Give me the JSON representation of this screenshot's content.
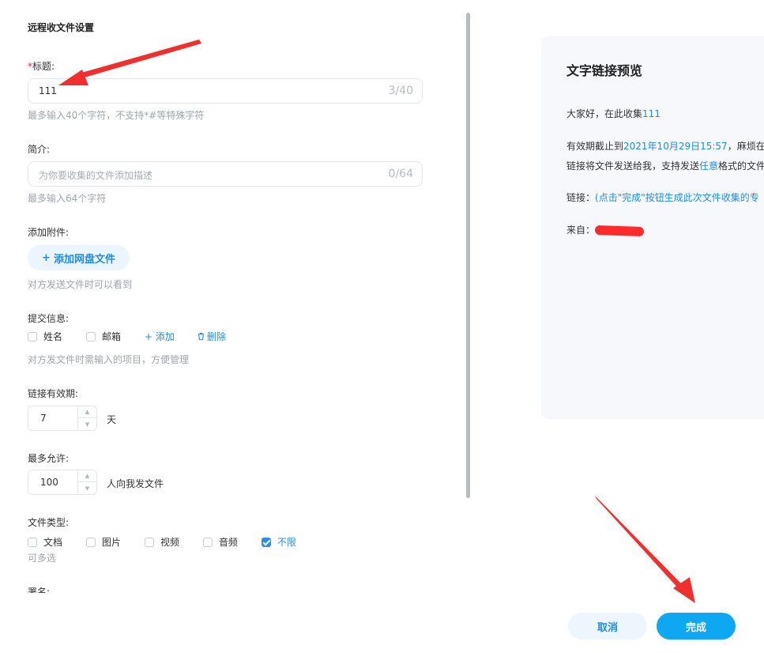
{
  "left": {
    "section_title": "远程收文件设置",
    "title_field": {
      "required_mark": "*",
      "label": "标题:",
      "value": "111",
      "counter": "3/40",
      "hint": "最多输入40个字符，不支持*#等特殊字符"
    },
    "intro_field": {
      "label": "简介:",
      "placeholder": "为你要收集的文件添加描述",
      "counter": "0/64",
      "hint": "最多输入64个字符"
    },
    "attachment": {
      "label": "添加附件:",
      "button_icon": "+",
      "button_label": "添加网盘文件",
      "hint": "对方发送文件时可以看到"
    },
    "submit_info": {
      "label": "提交信息:",
      "options": [
        {
          "label": "姓名",
          "checked": false
        },
        {
          "label": "邮箱",
          "checked": false
        }
      ],
      "add_label": "+ 添加",
      "delete_label": "删除",
      "hint": "对方发文件时需输入的项目，方便管理"
    },
    "validity": {
      "label": "链接有效期:",
      "value": "7",
      "unit": "天"
    },
    "max_allow": {
      "label": "最多允许:",
      "value": "100",
      "unit": "人向我发文件"
    },
    "file_type": {
      "label": "文件类型:",
      "options": [
        {
          "label": "文档",
          "checked": false
        },
        {
          "label": "图片",
          "checked": false
        },
        {
          "label": "视频",
          "checked": false
        },
        {
          "label": "音频",
          "checked": false
        },
        {
          "label": "不限",
          "checked": true
        }
      ],
      "hint": "可多选"
    },
    "cutoff_label": "署名:"
  },
  "preview": {
    "title": "文字链接预览",
    "greeting_prefix": "大家好，在此收集",
    "greeting_value": "111",
    "expiry_prefix": "有效期截止到",
    "expiry_date": "2021年10月29日15:57",
    "expiry_suffix": "，麻烦在此",
    "send_prefix": "链接将文件发送给我，支持发送",
    "send_highlight": "任意",
    "send_suffix": "格式的文件",
    "link_label": "链接：",
    "link_text": "(点击\"完成\"按钮生成此次文件收集的专",
    "from_label": "来自："
  },
  "footer": {
    "cancel_label": "取消",
    "done_label": "完成"
  },
  "colors": {
    "accent": "#1f8ce6",
    "primary_button": "#0ea7f2",
    "annotation_arrow": "#f0302e"
  }
}
